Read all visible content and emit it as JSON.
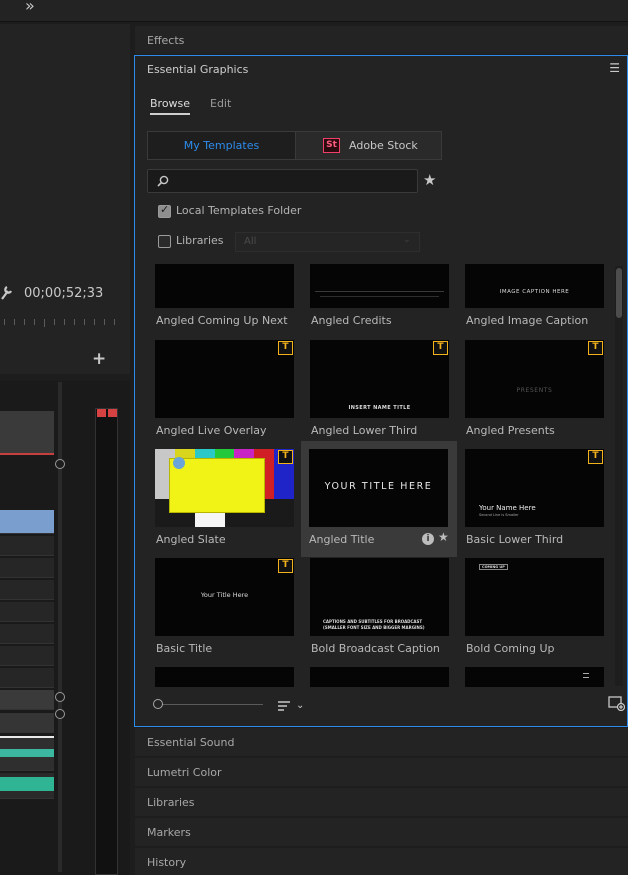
{
  "left": {
    "timecode": "00;00;52;33"
  },
  "panels": {
    "effects": "Effects",
    "essential_graphics": "Essential Graphics",
    "essential_sound": "Essential Sound",
    "lumetri_color": "Lumetri Color",
    "libraries": "Libraries",
    "markers": "Markers",
    "history": "History"
  },
  "eg": {
    "tabs": {
      "browse": "Browse",
      "edit": "Edit"
    },
    "segmented": {
      "my_templates": "My Templates",
      "adobe_stock": "Adobe Stock",
      "stock_badge": "St"
    },
    "search_placeholder": "",
    "local_templates_folder": "Local Templates Folder",
    "libraries_label": "Libraries",
    "libraries_select": "All",
    "templates": [
      {
        "name": "Angled Coming Up Next"
      },
      {
        "name": "Angled Credits"
      },
      {
        "name": "Angled Image Caption",
        "thumb_text": "IMAGE CAPTION HERE"
      },
      {
        "name": "Angled Live Overlay"
      },
      {
        "name": "Angled Lower Third",
        "thumb_text": "INSERT NAME TITLE"
      },
      {
        "name": "Angled Presents",
        "thumb_text": "PRESENTS"
      },
      {
        "name": "Angled Slate"
      },
      {
        "name": "Angled Title",
        "thumb_text": "YOUR TITLE HERE"
      },
      {
        "name": "Basic Lower Third",
        "thumb_text": "Your Name Here",
        "thumb_sub": "Second Line is Smaller"
      },
      {
        "name": "Basic Title",
        "thumb_text": "Your Title Here"
      },
      {
        "name": "Bold Broadcast Caption",
        "thumb_text": "CAPTIONS AND SUBTITLES FOR BROADCAST",
        "thumb_sub": "(SMALLER FONT SIZE AND BIGGER MARGINS)"
      },
      {
        "name": "Bold Coming Up",
        "thumb_text": "COMING UP"
      }
    ],
    "badge_letter": "T",
    "colors": {
      "accent": "#2d8ceb",
      "stock_red": "#f0406a",
      "badge_yellow": "#f2b21b"
    }
  }
}
